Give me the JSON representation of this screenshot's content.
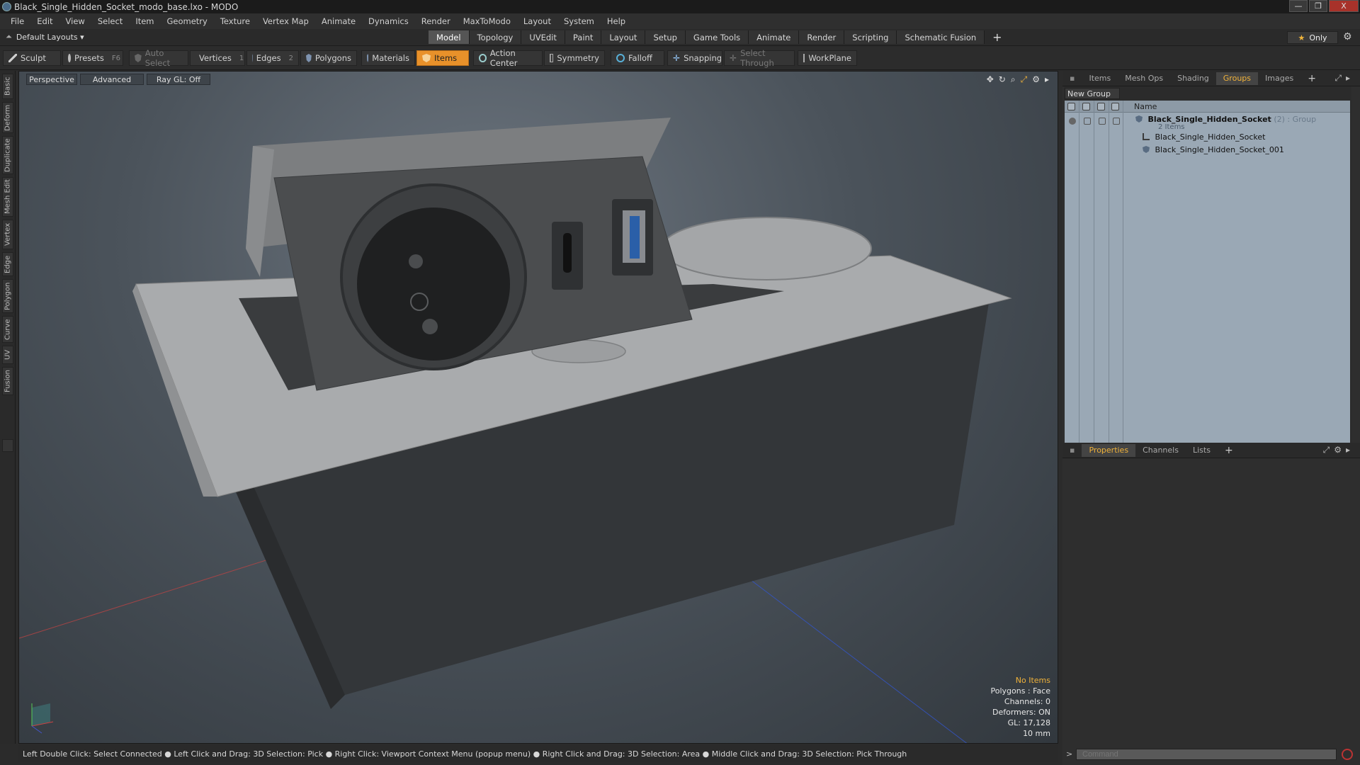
{
  "window": {
    "title": "Black_Single_Hidden_Socket_modo_base.lxo - MODO",
    "controls": [
      "—",
      "❐",
      "X"
    ]
  },
  "menu": [
    "File",
    "Edit",
    "View",
    "Select",
    "Item",
    "Geometry",
    "Texture",
    "Vertex Map",
    "Animate",
    "Dynamics",
    "Render",
    "MaxToModo",
    "Layout",
    "System",
    "Help"
  ],
  "layoutbar": {
    "default_layouts": "Default Layouts ▾",
    "tabs": [
      "Model",
      "Topology",
      "UVEdit",
      "Paint",
      "Layout",
      "Setup",
      "Game Tools",
      "Animate",
      "Render",
      "Scripting",
      "Schematic Fusion"
    ],
    "active_tab": "Model",
    "plus": "+",
    "only": "Only"
  },
  "toolbar": {
    "sculpt": "Sculpt",
    "presets": "Presets",
    "presets_key": "F6",
    "auto_select": "Auto Select",
    "vertices": "Vertices",
    "vertices_key": "1",
    "edges": "Edges",
    "edges_key": "2",
    "polygons": "Polygons",
    "materials": "Materials",
    "items": "Items",
    "action_center": "Action Center",
    "symmetry": "Symmetry",
    "falloff": "Falloff",
    "snapping": "Snapping",
    "select_through": "Select Through",
    "workplane": "WorkPlane"
  },
  "left_tabs": [
    "Basic",
    "Deform",
    "Duplicate",
    "Mesh Edit",
    "Vertex",
    "Edge",
    "Polygon",
    "Curve",
    "UV",
    "Fusion"
  ],
  "viewport": {
    "view": "Perspective",
    "shading": "Advanced",
    "raygl": "Ray GL: Off",
    "info": {
      "selection": "No Items",
      "polygons": "Polygons : Face",
      "channels": "Channels: 0",
      "deformers": "Deformers: ON",
      "gl": "GL: 17,128",
      "grid": "10 mm"
    }
  },
  "statusbar": "Left Double Click: Select Connected ● Left Click and Drag: 3D Selection: Pick ● Right Click: Viewport Context Menu (popup menu) ● Right Click and Drag: 3D Selection: Area ● Middle Click and Drag: 3D Selection: Pick Through",
  "right_panel": {
    "top_tabs": [
      "Items",
      "Mesh Ops",
      "Shading",
      "Groups",
      "Images"
    ],
    "top_active": "Groups",
    "new_group": "New Group",
    "tree_header_name": "Name",
    "group": {
      "name": "Black_Single_Hidden_Socket",
      "count": "(2)",
      "kind": ": Group",
      "subtitle": "2 Items",
      "children": [
        "Black_Single_Hidden_Socket",
        "Black_Single_Hidden_Socket_001"
      ]
    },
    "bottom_tabs": [
      "Properties",
      "Channels",
      "Lists"
    ],
    "bottom_active": "Properties",
    "command_placeholder": "Command"
  },
  "colors": {
    "accent_orange": "#e8912a",
    "active_tab_text": "#f0b23a",
    "tree_bg": "#9aa8b5"
  }
}
